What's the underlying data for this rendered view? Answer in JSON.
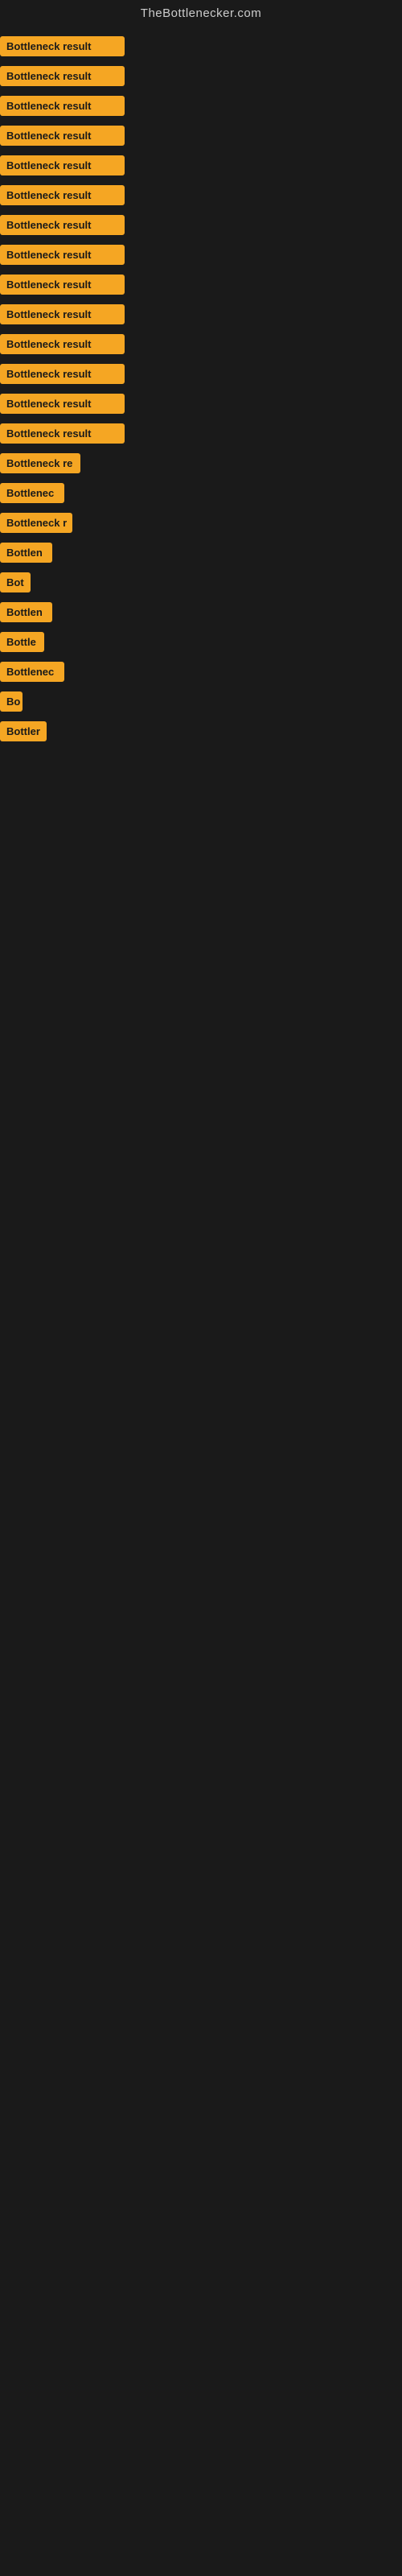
{
  "header": {
    "title": "TheBottlenecker.com"
  },
  "accent_color": "#f5a623",
  "results": [
    {
      "id": 1,
      "label": "Bottleneck result",
      "width": 155
    },
    {
      "id": 2,
      "label": "Bottleneck result",
      "width": 155
    },
    {
      "id": 3,
      "label": "Bottleneck result",
      "width": 155
    },
    {
      "id": 4,
      "label": "Bottleneck result",
      "width": 155
    },
    {
      "id": 5,
      "label": "Bottleneck result",
      "width": 155
    },
    {
      "id": 6,
      "label": "Bottleneck result",
      "width": 155
    },
    {
      "id": 7,
      "label": "Bottleneck result",
      "width": 155
    },
    {
      "id": 8,
      "label": "Bottleneck result",
      "width": 155
    },
    {
      "id": 9,
      "label": "Bottleneck result",
      "width": 155
    },
    {
      "id": 10,
      "label": "Bottleneck result",
      "width": 155
    },
    {
      "id": 11,
      "label": "Bottleneck result",
      "width": 155
    },
    {
      "id": 12,
      "label": "Bottleneck result",
      "width": 155
    },
    {
      "id": 13,
      "label": "Bottleneck result",
      "width": 155
    },
    {
      "id": 14,
      "label": "Bottleneck result",
      "width": 155
    },
    {
      "id": 15,
      "label": "Bottleneck re",
      "width": 100
    },
    {
      "id": 16,
      "label": "Bottlenec",
      "width": 80
    },
    {
      "id": 17,
      "label": "Bottleneck r",
      "width": 90
    },
    {
      "id": 18,
      "label": "Bottlen",
      "width": 65
    },
    {
      "id": 19,
      "label": "Bot",
      "width": 38
    },
    {
      "id": 20,
      "label": "Bottlen",
      "width": 65
    },
    {
      "id": 21,
      "label": "Bottle",
      "width": 55
    },
    {
      "id": 22,
      "label": "Bottlenec",
      "width": 80
    },
    {
      "id": 23,
      "label": "Bo",
      "width": 28
    },
    {
      "id": 24,
      "label": "Bottler",
      "width": 58
    }
  ]
}
